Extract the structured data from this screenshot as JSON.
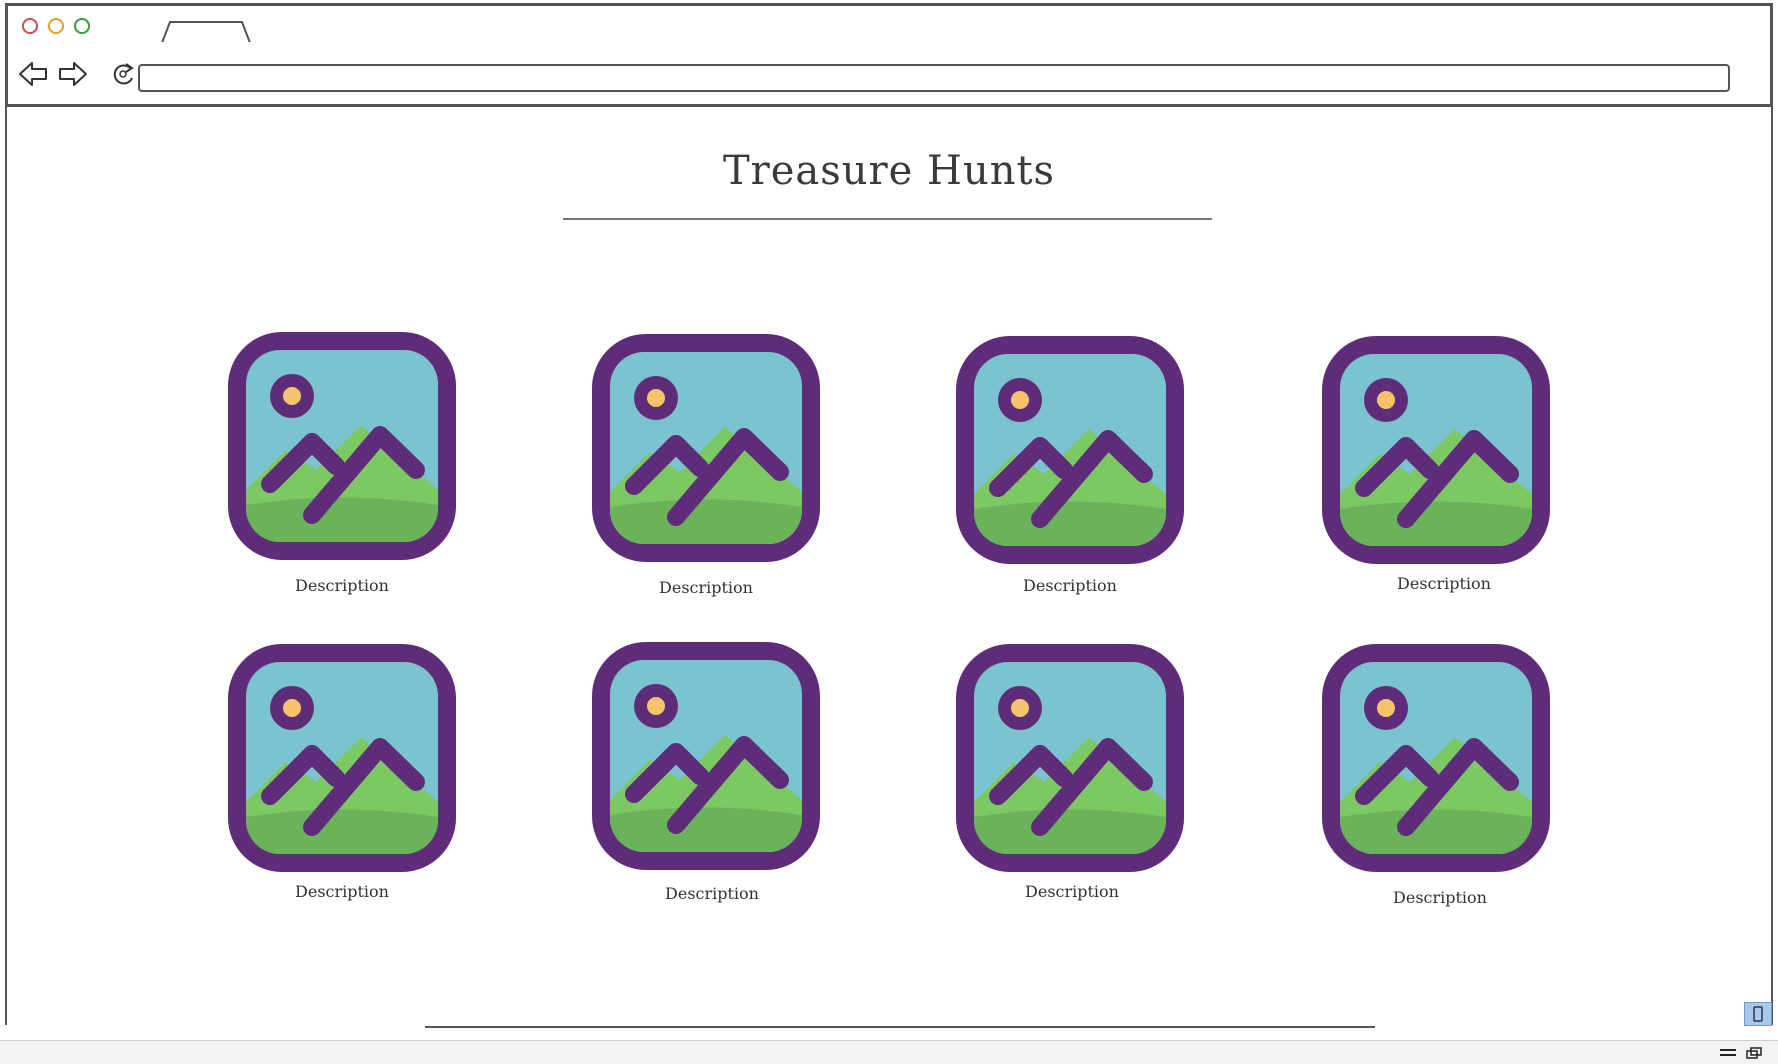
{
  "browser": {
    "address_value": "",
    "icons": {
      "back": "arrow-left-icon",
      "forward": "arrow-right-icon",
      "reload": "reload-icon"
    }
  },
  "page": {
    "title": "Treasure Hunts"
  },
  "gallery": {
    "items": [
      {
        "description": "Description",
        "icon": "image-placeholder-icon"
      },
      {
        "description": "Description",
        "icon": "image-placeholder-icon"
      },
      {
        "description": "Description",
        "icon": "image-placeholder-icon"
      },
      {
        "description": "Description",
        "icon": "image-placeholder-icon"
      },
      {
        "description": "Description",
        "icon": "image-placeholder-icon"
      },
      {
        "description": "Description",
        "icon": "image-placeholder-icon"
      },
      {
        "description": "Description",
        "icon": "image-placeholder-icon"
      },
      {
        "description": "Description",
        "icon": "image-placeholder-icon"
      }
    ]
  },
  "colors": {
    "frame": "#5f2c7a",
    "sky": "#7bc3cf",
    "sun": "#f6c36b",
    "hill_light": "#7cc862",
    "hill_dark": "#6ab35a",
    "traffic_red": "#c0504d",
    "traffic_yellow": "#e0a030",
    "traffic_green": "#3a9a3a"
  }
}
